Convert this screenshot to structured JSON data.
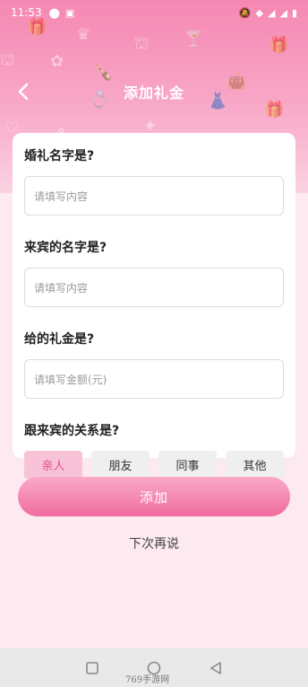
{
  "status_bar": {
    "time": "11:53"
  },
  "nav": {
    "title": "添加礼金",
    "back_label": "back"
  },
  "form": {
    "fields": [
      {
        "label": "婚礼名字是?",
        "placeholder": "请填写内容"
      },
      {
        "label": "来宾的名字是?",
        "placeholder": "请填写内容"
      },
      {
        "label": "给的礼金是?",
        "placeholder": "请填写金额(元)"
      }
    ],
    "relation": {
      "label": "跟来宾的关系是?",
      "options": [
        "亲人",
        "朋友",
        "同事",
        "其他"
      ],
      "selected": "亲人"
    }
  },
  "actions": {
    "add_label": "添加",
    "later_label": "下次再说"
  },
  "watermark": "769手游网",
  "colors": {
    "accent": "#f06c9e",
    "header": "#f588b3",
    "background": "#fde9f0"
  }
}
